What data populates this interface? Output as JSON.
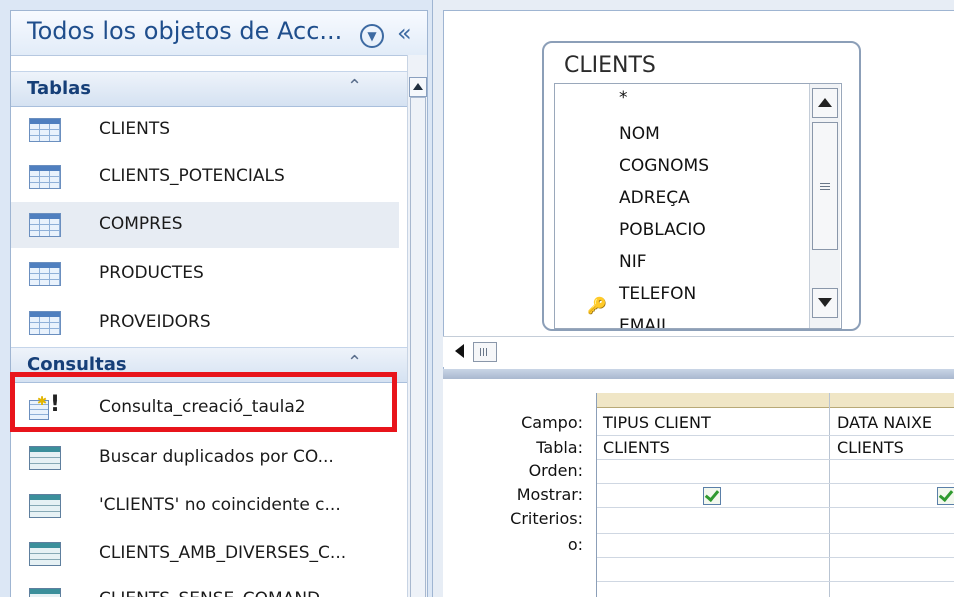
{
  "nav": {
    "title": "Todos los objetos de Acc...",
    "groups": {
      "tables": {
        "label": "Tablas",
        "items": [
          "CLIENTS",
          "CLIENTS_POTENCIALS",
          "COMPRES",
          "PRODUCTES",
          "PROVEIDORS"
        ]
      },
      "queries": {
        "label": "Consultas",
        "items": [
          "Consulta_creació_taula2",
          "Buscar duplicados por CO...",
          "'CLIENTS' no coincidente c...",
          "CLIENTS_AMB_DIVERSES_C...",
          "CLIENTS_SENSE_COMAND..."
        ]
      }
    },
    "selected_item": "COMPRES",
    "highlight_color": "#e8141b"
  },
  "design": {
    "table": {
      "title": "CLIENTS",
      "fields": [
        "*",
        "NOM",
        "COGNOMS",
        "ADREÇA",
        "POBLACIO",
        "NIF",
        "TELEFON",
        "EMAIL"
      ],
      "key_field": "NIF"
    },
    "grid": {
      "row_labels": [
        "Campo:",
        "Tabla:",
        "Orden:",
        "Mostrar:",
        "Criterios:",
        "o:"
      ],
      "columns": [
        {
          "campo": "TIPUS CLIENT",
          "tabla": "CLIENTS",
          "mostrar": true
        },
        {
          "campo": "DATA NAIXE",
          "tabla": "CLIENTS",
          "mostrar": true
        }
      ]
    }
  }
}
